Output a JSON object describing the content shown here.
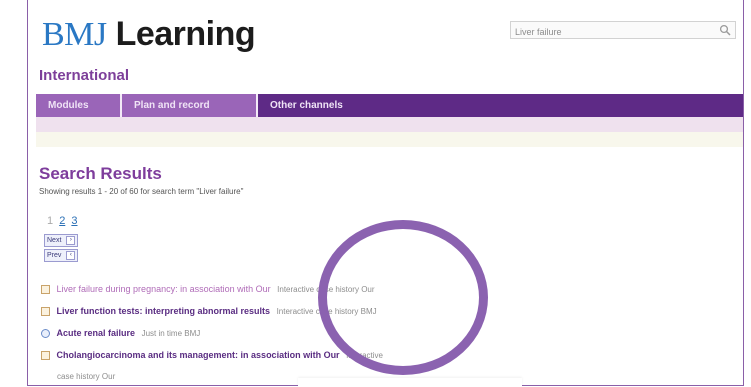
{
  "logo": {
    "part1": "BMJ",
    "part2": "Learning"
  },
  "search": {
    "value": "Liver failure"
  },
  "region": "International",
  "nav": {
    "tabs": [
      "Modules",
      "Plan and record",
      "Other channels"
    ]
  },
  "results": {
    "title": "Search Results",
    "summary": "Showing results 1 - 20 of 60 for search term \"Liver failure\"",
    "pager": {
      "current": "1",
      "pages": [
        "2",
        "3"
      ]
    },
    "next_label": "Next",
    "prev_label": "Prev",
    "items": [
      {
        "title": "Liver failure during pregnancy: in association with Our",
        "meta": "Interactive case history Our"
      },
      {
        "title": "Liver function tests: interpreting abnormal results",
        "meta": "Interactive case history BMJ"
      },
      {
        "title": "Acute renal failure",
        "meta": "Just in time BMJ"
      },
      {
        "title": "Cholangiocarcinoma and its management: in association with Our",
        "meta": "Interactive"
      }
    ],
    "last_meta_wrap": "case history Our"
  },
  "colors": {
    "accent": "#5e2a86",
    "brand_blue": "#2a78c4",
    "circle": "#8b62b0"
  }
}
